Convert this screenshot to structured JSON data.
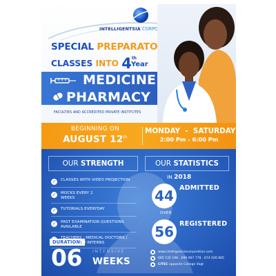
{
  "corporation": {
    "name": "INTELLIGENTSIA",
    "suffix": "CORPORATION"
  },
  "headline": {
    "special": "SPECIAL",
    "preparatory": "PREPARATORY",
    "classes": "CLASSES",
    "into": "INTO",
    "year_number": "4",
    "year_ordinal": "th",
    "year_word": "Year"
  },
  "programs": {
    "medicine": "MEDICINE &",
    "pharmacy": "PHARMACY"
  },
  "faculties": "FACULTIES AND ACCREDITED PRIVATE INSTITUTES",
  "schedule": {
    "beginning": "BEGINNING ON",
    "date": "AUGUST 12",
    "date_ordinal": "th",
    "days": "MONDAY  -  SATURDAY",
    "hours": "2:00 Pm  -  6:00 Pm"
  },
  "strength": {
    "heading_pre": "OUR",
    "heading_bold": "STRENGTH",
    "items": [
      "CLASSES WITH VIDEO PROJECTION",
      "MOCKS EVERY 2 WEEKS",
      "TUTORIALS EVERYDAY",
      "PAST EXAMINATION QUESTIONS AVAILABLE",
      "TEACHERS : MEDICAL DOCTORS / RESIDENTS / INTERNS"
    ]
  },
  "duration": {
    "label": "DURATION:",
    "number": "06",
    "intensive": "INTENSIVE",
    "weeks": "WEEKS"
  },
  "statistics": {
    "heading_pre": "OUR",
    "heading_bold": "STATISTICS",
    "in_label": "IN",
    "year": "2018",
    "admitted_number": "44",
    "admitted_label": "ADMITTED",
    "over_label": "OVER",
    "registered_number": "56",
    "registered_label": "REGISTERED"
  },
  "contacts": {
    "website": "www.intelligentsiacorporation.com",
    "phones": "695 535 198 , 699 907 778 , 674 026 805",
    "location_bold": "CITEC",
    "location_rest": "opposite College Vogt"
  },
  "colors": {
    "brand_blue": "#1d4fb8",
    "accent_orange": "#f49a1b",
    "lower_blue": "#2a62c0"
  }
}
